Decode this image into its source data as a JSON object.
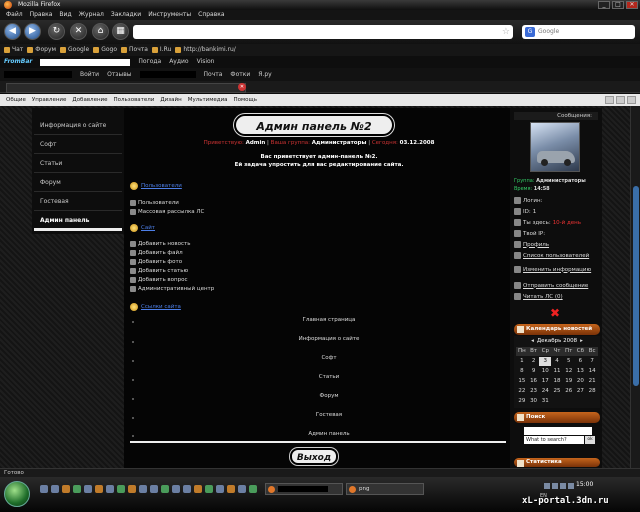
{
  "window": {
    "title": "Mozilla Firefox"
  },
  "menu": [
    "Файл",
    "Правка",
    "Вид",
    "Журнал",
    "Закладки",
    "Инструменты",
    "Справка"
  ],
  "search": {
    "placeholder": "Google"
  },
  "bookmarks": [
    "Чат",
    "Форум",
    "Google",
    "Gogo",
    "Почта",
    "I.Ru",
    "http://bankimi.ru/"
  ],
  "toolbar2": {
    "logo": "FromBar",
    "items": [
      "Погода",
      "Аудио",
      "Vision"
    ]
  },
  "toolbar3": {
    "items": [
      "Войти",
      "Отзывы",
      "Почта",
      "Фотки",
      "Я.ру"
    ]
  },
  "site_menu": [
    "Общие",
    "Управление",
    "Добавление",
    "Пользователи",
    "Дизайн",
    "Мультимедиа",
    "Помощь"
  ],
  "left_nav": [
    {
      "label": "Информация о сайте"
    },
    {
      "label": "Софт"
    },
    {
      "label": "Статьи"
    },
    {
      "label": "Форум"
    },
    {
      "label": "Гостевая"
    },
    {
      "label": "Админ панель"
    }
  ],
  "main": {
    "title": "Админ панель №2",
    "info": {
      "greeting_label": "Приветствую:",
      "user": "Admin",
      "group_label": "Ваша группа:",
      "group": "Администраторы",
      "today_label": "Сегодня:",
      "date": "03.12.2008"
    },
    "welcome_line1": "Вас приветствует админ-панель №2.",
    "welcome_line2": "Ей задача упростить для вас редактирование сайта.",
    "sections": [
      {
        "title": "Пользователи",
        "items": [
          "Пользователи",
          "Массовая рассылка ЛС"
        ]
      },
      {
        "title": "Сайт",
        "items": [
          "Добавить новость",
          "Добавить файл",
          "Добавить фото",
          "Добавить статью",
          "Добавить вопрос",
          "Административный центр"
        ]
      },
      {
        "title": "Ссылки сайта"
      }
    ],
    "center_links": [
      "Главная страница",
      "Информация о сайте",
      "Софт",
      "Статьи",
      "Форум",
      "Гостевая",
      "Админ панель"
    ],
    "exit_label": "Выход"
  },
  "right": {
    "header": "Сообщения:",
    "group_label": "Группа:",
    "group": "Администраторы",
    "time_label": "Время:",
    "time": "14:58",
    "profile": [
      {
        "label": "Логин:",
        "value": ""
      },
      {
        "label": "ID:",
        "value": "1"
      },
      {
        "label": "Ты здесь:",
        "value": "10-й день"
      },
      {
        "label": "Твой IP:",
        "value": ""
      },
      {
        "label": "Профиль",
        "value": ""
      },
      {
        "label": "Список пользователей",
        "value": ""
      },
      {
        "label": "Изменить информацию",
        "value": ""
      },
      {
        "label": "Отправить сообщение",
        "value": ""
      },
      {
        "label": "Читать ЛС (0)",
        "value": ""
      }
    ],
    "panels": [
      {
        "title": "Календарь новостей"
      },
      {
        "title": "Поиск"
      },
      {
        "title": "Статистика"
      }
    ],
    "calendar": {
      "month": "Декабрь 2008",
      "weekdays": [
        "Пн",
        "Вт",
        "Ср",
        "Чт",
        "Пт",
        "Сб",
        "Вс"
      ],
      "days": [
        "1",
        "2",
        "3",
        "4",
        "5",
        "6",
        "7",
        "8",
        "9",
        "10",
        "11",
        "12",
        "13",
        "14",
        "15",
        "16",
        "17",
        "18",
        "19",
        "20",
        "21",
        "22",
        "23",
        "24",
        "25",
        "26",
        "27",
        "28",
        "29",
        "30",
        "31"
      ],
      "today": "3"
    },
    "search_select": "What to search?",
    "search_go": "ok"
  },
  "statusbar": {
    "text": "Готово"
  },
  "taskbar": {
    "task2": "png",
    "lang": "EN",
    "clock": "15:00"
  },
  "watermark": "xL-portal.3dn.ru"
}
